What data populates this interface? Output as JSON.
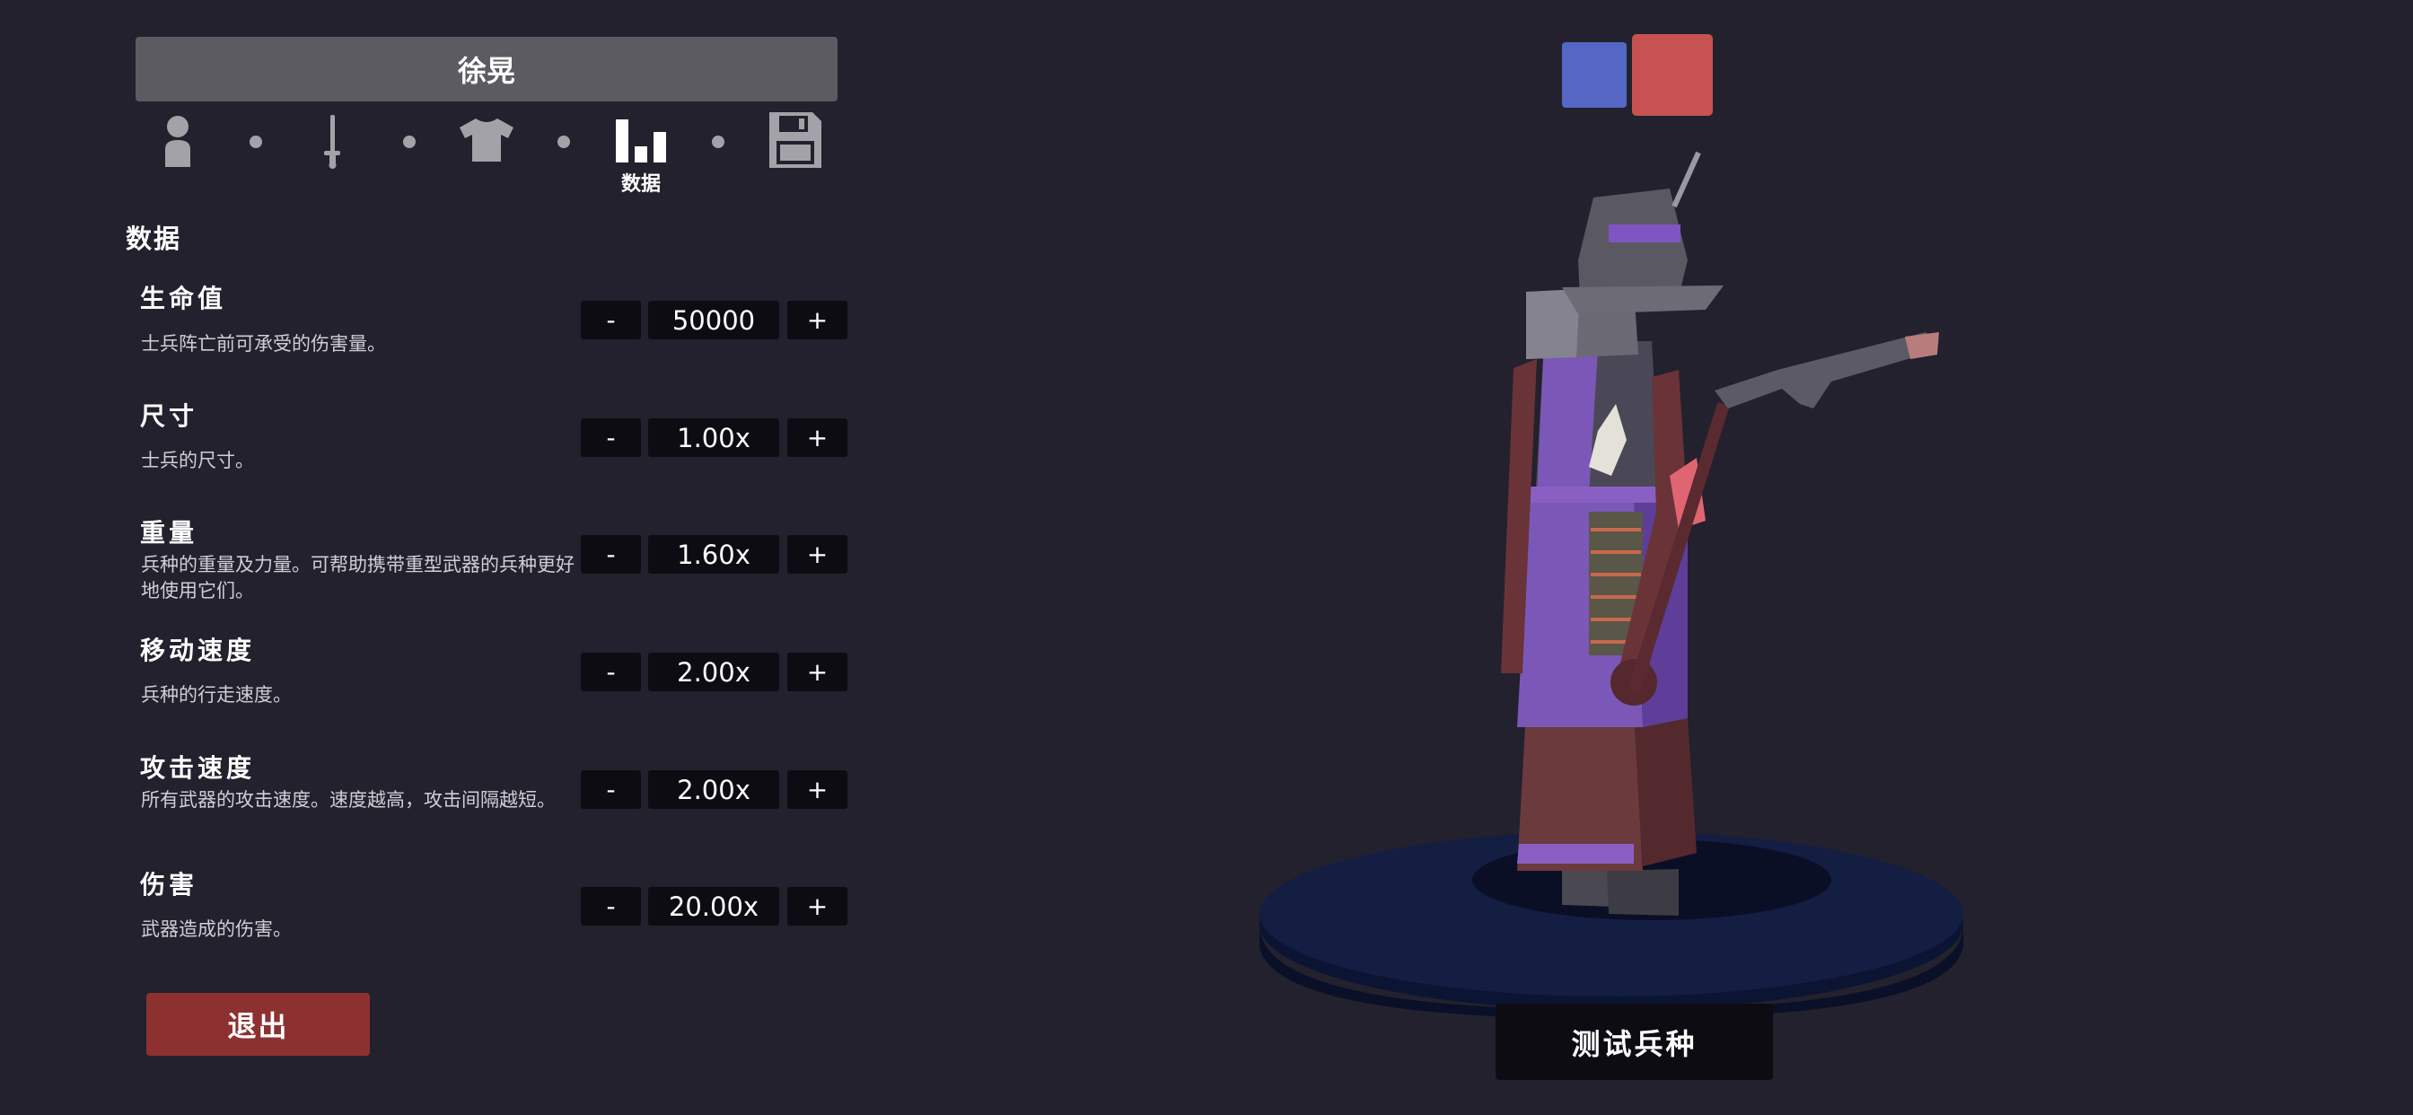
{
  "unit_name": "徐晃",
  "tabs": [
    {
      "id": "appearance",
      "icon": "person-icon",
      "label": ""
    },
    {
      "id": "weapons",
      "icon": "sword-icon",
      "label": ""
    },
    {
      "id": "clothing",
      "icon": "shirt-icon",
      "label": ""
    },
    {
      "id": "stats",
      "icon": "bar-chart-icon",
      "label": "数据"
    },
    {
      "id": "save",
      "icon": "floppy-disk-icon",
      "label": ""
    }
  ],
  "section_title": "数据",
  "stats": [
    {
      "name": "生命值",
      "description": "士兵阵亡前可承受的伤害量。",
      "value": "50000",
      "minus": "-",
      "plus": "+"
    },
    {
      "name": "尺寸",
      "description": "士兵的尺寸。",
      "value": "1.00x",
      "minus": "-",
      "plus": "+"
    },
    {
      "name": "重量",
      "description": "兵种的重量及力量。可帮助携带重型武器的兵种更好地使用它们。",
      "value": "1.60x",
      "minus": "-",
      "plus": "+"
    },
    {
      "name": "移动速度",
      "description": "兵种的行走速度。",
      "value": "2.00x",
      "minus": "-",
      "plus": "+"
    },
    {
      "name": "攻击速度",
      "description": "所有武器的攻击速度。速度越高，攻击间隔越短。",
      "value": "2.00x",
      "minus": "-",
      "plus": "+"
    },
    {
      "name": "伤害",
      "description": "武器造成的伤害。",
      "value": "20.00x",
      "minus": "-",
      "plus": "+"
    }
  ],
  "exit_label": "退出",
  "test_label": "测试兵种",
  "team_colors": {
    "blue": "#5467c4",
    "red": "#c65252"
  }
}
